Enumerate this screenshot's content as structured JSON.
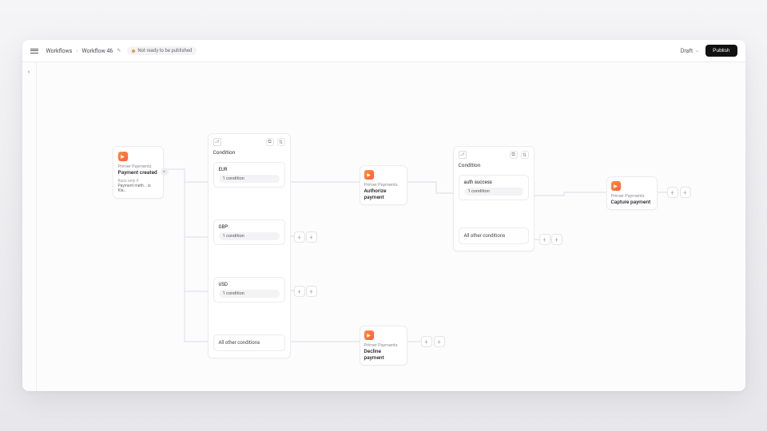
{
  "header": {
    "breadcrumb_root": "Workflows",
    "breadcrumb_current": "Workflow 46",
    "status_text": "Not ready to be published",
    "draft_label": "Draft",
    "publish_label": "Publish"
  },
  "trigger": {
    "provider": "Primer Payments",
    "title": "Payment created",
    "meta_label": "Runs only if",
    "meta_value": "Payment meth... is Kla..."
  },
  "conditionA": {
    "title": "Condition",
    "branches": [
      {
        "name": "EUR",
        "meta": "1 condition"
      },
      {
        "name": "GBP",
        "meta": "1 condition"
      },
      {
        "name": "USD",
        "meta": "1 condition"
      }
    ],
    "else_label": "All other conditions"
  },
  "authorize": {
    "provider": "Primer Payments",
    "title": "Authorize payment"
  },
  "decline": {
    "provider": "Primer Payments",
    "title": "Decline payment"
  },
  "conditionB": {
    "title": "Condition",
    "branches": [
      {
        "name": "auth success",
        "meta": "1 condition"
      }
    ],
    "else_label": "All other conditions"
  },
  "capture": {
    "provider": "Primer Payments",
    "title": "Capture payment"
  }
}
